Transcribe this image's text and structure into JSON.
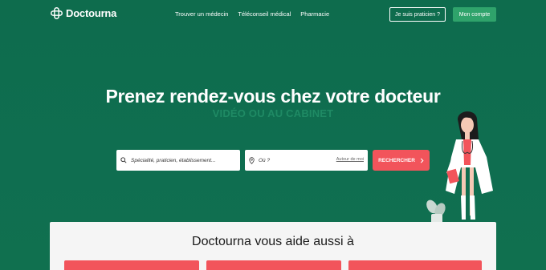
{
  "nav": {
    "logo_text": "Doctourna",
    "links": [
      {
        "label": "Trouver un médecin"
      },
      {
        "label": "Téléconseil médical"
      },
      {
        "label": "Pharmacie"
      }
    ],
    "pro_button": "Je suis praticien ?",
    "account_button": "Mon compte"
  },
  "hero": {
    "title": "Prenez rendez-vous chez votre docteur",
    "subtitle": "VIDÉO OU AU CABINET"
  },
  "search": {
    "specialty_placeholder": "Spécialité, praticien, établissement...",
    "location_placeholder": "Où ?",
    "near_me": "Autour de moi",
    "button": "RECHERCHER"
  },
  "section": {
    "title": "Doctourna vous aide aussi à"
  },
  "colors": {
    "background": "#0f6e4f",
    "accent": "#f2545b",
    "account_button": "#2fa36b",
    "subtitle": "#1f8a64"
  },
  "icons": [
    "logo-cross-icon",
    "search-icon",
    "location-pin-icon",
    "chevron-right-icon",
    "plant-icon"
  ]
}
